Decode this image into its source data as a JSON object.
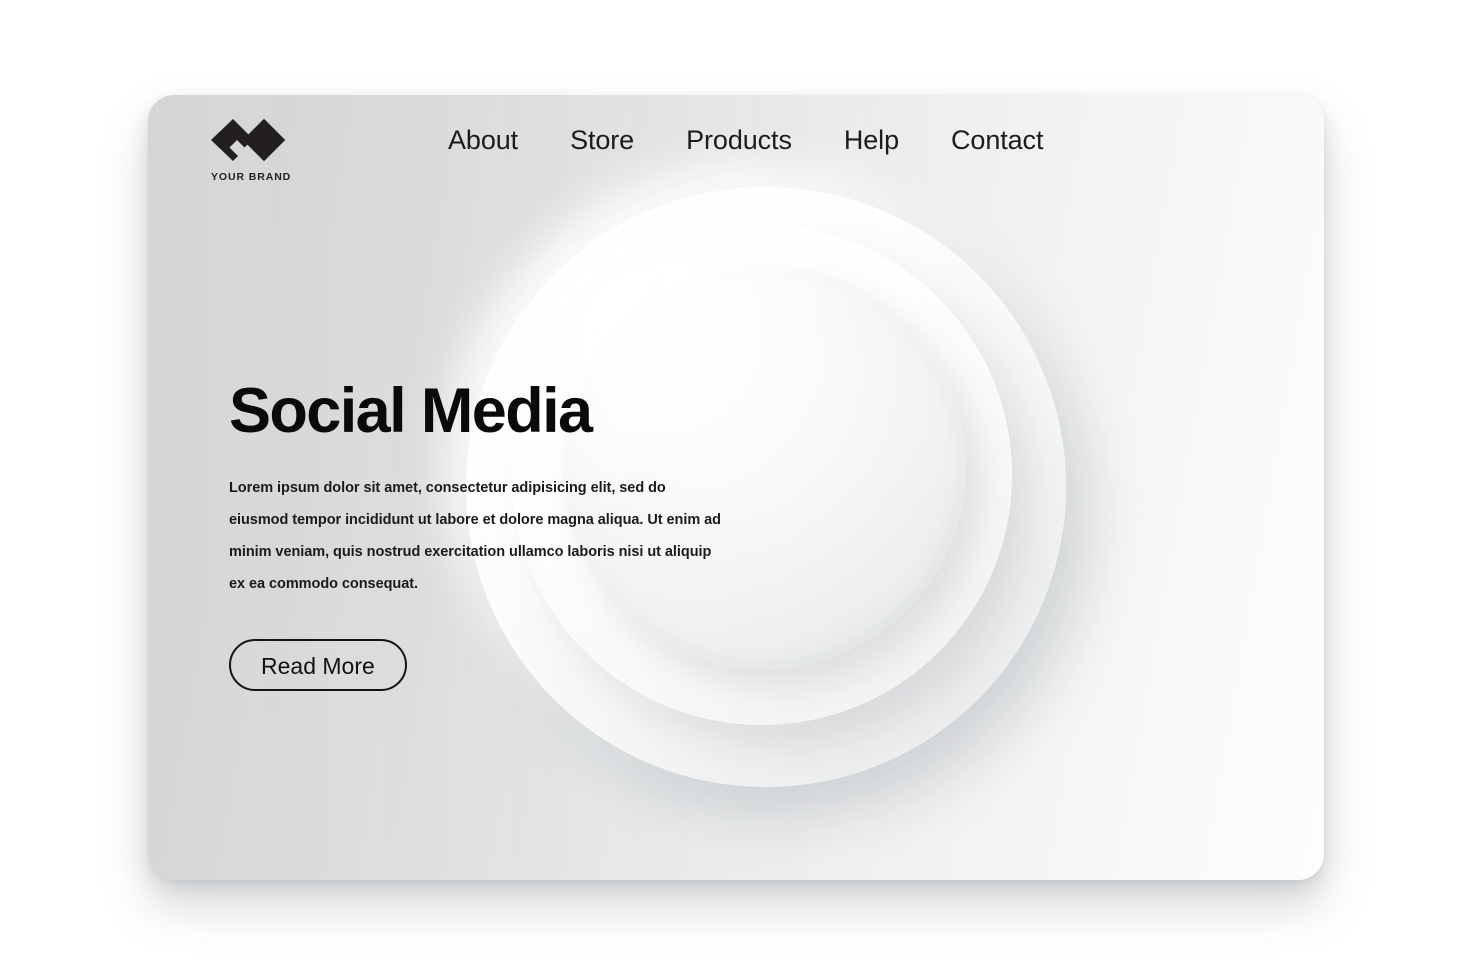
{
  "page": {
    "background_color": "#ffffff"
  },
  "card": {
    "background_start": "#d3d5d7",
    "background_end": "#fdfdfd",
    "corner_radius": "26px"
  },
  "header": {
    "brand": {
      "name": "YOUR BRAND",
      "mark_icon": "double-diamond-logo-icon",
      "mark_color": "#231f20"
    },
    "nav": [
      {
        "label": "About"
      },
      {
        "label": "Store"
      },
      {
        "label": "Products"
      },
      {
        "label": "Help"
      },
      {
        "label": "Contact"
      }
    ]
  },
  "hero": {
    "title": "Social Media",
    "body": "Lorem ipsum dolor sit amet, consectetur adipisicing elit, sed do eiusmod tempor incididunt ut labore et dolore magna aliqua. Ut enim ad minim veniam, quis nostrud exercitation ullamco laboris nisi ut aliquip ex ea commodo consequat.",
    "cta_label": "Read More",
    "text_color": "#0a0a0a"
  },
  "decoration": {
    "shape": "neumorphic-concentric-circles",
    "ring_count": 3,
    "highlight_color": "#ffffff",
    "shadow_color": "#969ba0"
  }
}
